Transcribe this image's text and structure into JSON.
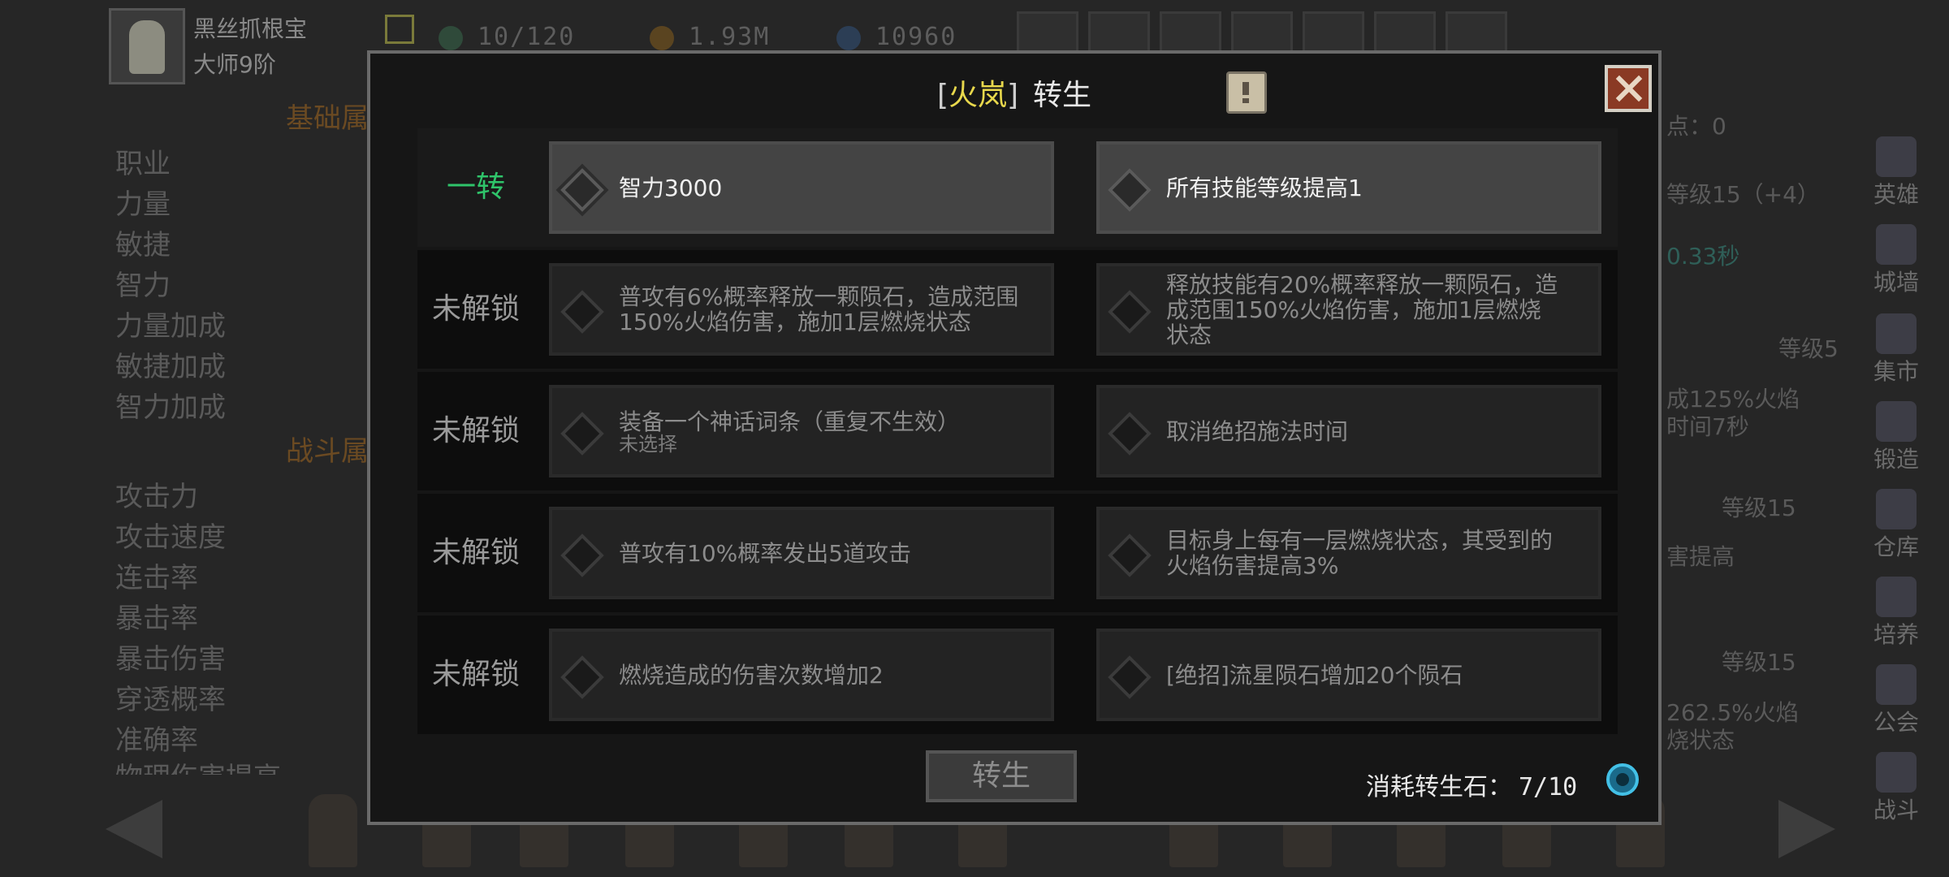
{
  "player": {
    "name": "黑丝抓根宝",
    "rank": "大师9阶"
  },
  "resources": {
    "energy": "10/120",
    "gold": "1.93M",
    "gems": "10960"
  },
  "background": {
    "section_basic": "基础属",
    "section_battle": "战斗属",
    "basic_stats": [
      "职业",
      "力量",
      "敏捷",
      "智力",
      "力量加成",
      "敏捷加成",
      "智力加成"
    ],
    "battle_stats": [
      "攻击力",
      "攻击速度",
      "连击率",
      "暴击率",
      "暴击伤害",
      "穿透概率",
      "准确率",
      "物理伤害提高"
    ],
    "right_texts": [
      "点：0",
      "等级15（+4）",
      "0.33秒",
      "等级5",
      "成125%火焰",
      "时间7秒",
      "等级15",
      "害提高",
      "等级15",
      "262.5%火焰",
      "烧状态"
    ]
  },
  "sidebar": [
    {
      "label": "英雄"
    },
    {
      "label": "城墙"
    },
    {
      "label": "集市"
    },
    {
      "label": "锻造"
    },
    {
      "label": "仓库"
    },
    {
      "label": "培养"
    },
    {
      "label": "公会"
    },
    {
      "label": "战斗"
    }
  ],
  "modal": {
    "title_bracket_open": "[",
    "hero_name": "火岚",
    "title_bracket_close": "]",
    "title_label": "转生",
    "rows": [
      {
        "label": "一转",
        "active": true,
        "option_a": {
          "line1": "智力3000",
          "line2": "",
          "selected": true
        },
        "option_b": {
          "line1": "所有技能等级提高1",
          "line2": ""
        }
      },
      {
        "label": "未解锁",
        "active": false,
        "option_a": {
          "line1": "普攻有6%概率释放一颗陨石，造成范围",
          "line2": "150%火焰伤害，施加1层燃烧状态"
        },
        "option_b": {
          "line1": "释放技能有20%概率释放一颗陨石，造",
          "line2": "成范围150%火焰伤害，施加1层燃烧",
          "line3": "状态"
        }
      },
      {
        "label": "未解锁",
        "active": false,
        "option_a": {
          "line1": "装备一个神话词条（重复不生效）",
          "sub": "未选择"
        },
        "option_b": {
          "line1": "取消绝招施法时间",
          "line2": ""
        }
      },
      {
        "label": "未解锁",
        "active": false,
        "option_a": {
          "line1": "普攻有10%概率发出5道攻击",
          "line2": ""
        },
        "option_b": {
          "line1": "目标身上每有一层燃烧状态，其受到的",
          "line2": "火焰伤害提高3%"
        }
      },
      {
        "label": "未解锁",
        "active": false,
        "option_a": {
          "line1": "燃烧造成的伤害次数增加2",
          "line2": ""
        },
        "option_b": {
          "line1": "[绝招]流星陨石增加20个陨石",
          "line2": ""
        }
      }
    ],
    "rebirth_button": "转生",
    "cost_label": "消耗转生石：",
    "cost_value": "7/10"
  },
  "colors": {
    "hero_name": "#e8d84c",
    "unlocked_label": "#2fc46a",
    "selected_gem": "#c9823e"
  }
}
